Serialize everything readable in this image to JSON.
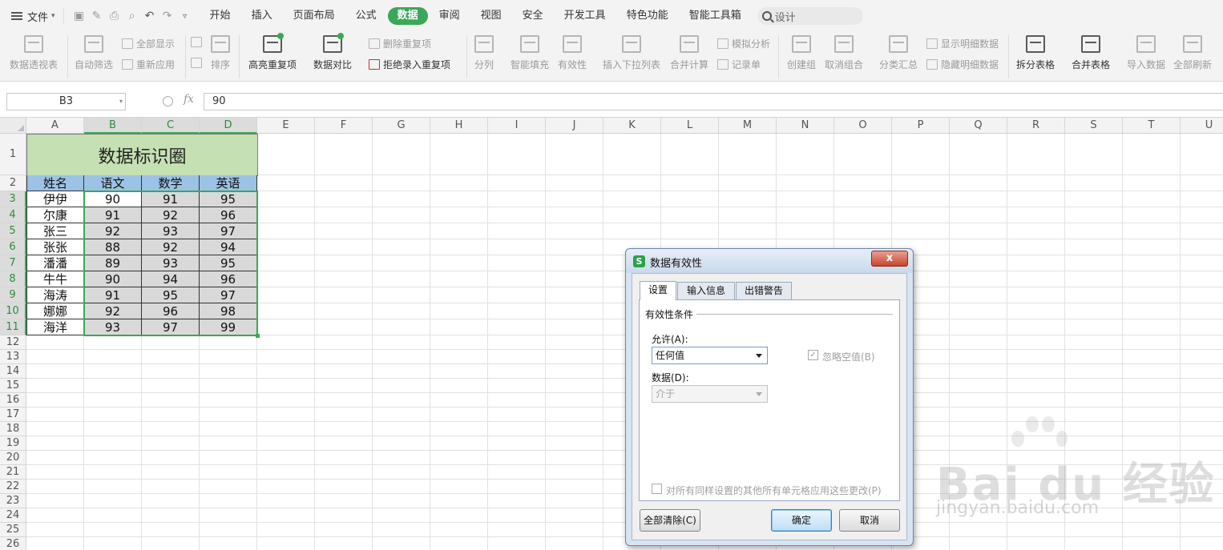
{
  "menubar": {
    "file_label": "文件",
    "tabs": [
      {
        "label": "开始",
        "active": false
      },
      {
        "label": "插入",
        "active": false
      },
      {
        "label": "页面布局",
        "active": false
      },
      {
        "label": "公式",
        "active": false
      },
      {
        "label": "数据",
        "active": true
      },
      {
        "label": "审阅",
        "active": false
      },
      {
        "label": "视图",
        "active": false
      },
      {
        "label": "安全",
        "active": false
      },
      {
        "label": "开发工具",
        "active": false
      },
      {
        "label": "特色功能",
        "active": false
      },
      {
        "label": "智能工具箱",
        "active": false
      }
    ],
    "search_placeholder": "设计",
    "accent_color": "#3aa858"
  },
  "ribbon": {
    "pivot": "数据透视表",
    "auto_filter": "自动筛选",
    "show_all": "全部显示",
    "reapply": "重新应用",
    "sort": "排序",
    "highlight_dup": "高亮重复项",
    "compare": "数据对比",
    "remove_dup": "删除重复项",
    "reject_dup": "拒绝录入重复项",
    "split_col": "分列",
    "smart_fill": "智能填充",
    "validity": "有效性",
    "insert_dropdown": "插入下拉列表",
    "consolidate": "合并计算",
    "simulate": "模拟分析",
    "record_sheet": "记录单",
    "create_group": "创建组",
    "ungroup": "取消组合",
    "subtotal": "分类汇总",
    "show_detail": "显示明细数据",
    "hide_detail": "隐藏明细数据",
    "split_table": "拆分表格",
    "merge_table": "合并表格",
    "import_data": "导入数据",
    "refresh_all": "全部刷新"
  },
  "formula_bar": {
    "name_box": "B3",
    "fx": "fx",
    "value": "90"
  },
  "grid": {
    "columns": [
      "A",
      "B",
      "C",
      "D",
      "E",
      "F",
      "G",
      "H",
      "I",
      "J",
      "K",
      "L",
      "M",
      "N",
      "O",
      "P",
      "Q",
      "R",
      "S",
      "T",
      "U"
    ],
    "rows": [
      "1",
      "2",
      "3",
      "4",
      "5",
      "6",
      "7",
      "8",
      "9",
      "10",
      "11",
      "12",
      "13",
      "14",
      "15",
      "16",
      "17",
      "18",
      "19",
      "20",
      "21",
      "22",
      "23",
      "24",
      "25",
      "26"
    ],
    "title": "数据标识圈",
    "headers": [
      "姓名",
      "语文",
      "数学",
      "英语"
    ],
    "data": [
      [
        "伊伊",
        "90",
        "91",
        "95"
      ],
      [
        "尔康",
        "91",
        "92",
        "96"
      ],
      [
        "张三",
        "92",
        "93",
        "97"
      ],
      [
        "张张",
        "88",
        "92",
        "94"
      ],
      [
        "潘潘",
        "89",
        "93",
        "95"
      ],
      [
        "牛牛",
        "90",
        "94",
        "96"
      ],
      [
        "海涛",
        "91",
        "95",
        "97"
      ],
      [
        "娜娜",
        "92",
        "96",
        "98"
      ],
      [
        "海洋",
        "93",
        "97",
        "99"
      ]
    ],
    "title_bg": "#c5e0b3",
    "header_bg": "#9cc2e5",
    "value_bg": "#d9d9d9"
  },
  "dialog": {
    "title": "数据有效性",
    "close": "x",
    "tabs": [
      "设置",
      "输入信息",
      "出错警告"
    ],
    "group_title": "有效性条件",
    "allow_label": "允许(A):",
    "allow_value": "任何值",
    "ignore_blank": "忽略空值(B)",
    "data_label": "数据(D):",
    "data_value": "介于",
    "apply_all": "对所有同样设置的其他所有单元格应用这些更改(P)",
    "clear_all": "全部清除(C)",
    "ok": "确定",
    "cancel": "取消"
  },
  "watermark": {
    "brand": "Bai du 经验",
    "url": "jingyan.baidu.com"
  }
}
